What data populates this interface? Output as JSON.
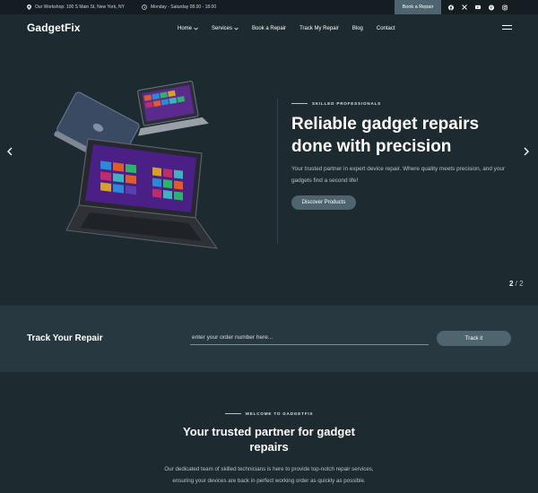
{
  "topbar": {
    "address": "Our Workshop: 100 S Main St, New York, NY",
    "hours": "Monday - Saturday 08.00 - 18.00",
    "cta_label": "Book a Repair",
    "socials": [
      "facebook-icon",
      "x-icon",
      "youtube-icon",
      "pinterest-icon",
      "instagram-icon"
    ]
  },
  "header": {
    "logo": "GadgetFix",
    "nav": [
      {
        "label": "Home",
        "dropdown": true
      },
      {
        "label": "Services",
        "dropdown": true
      },
      {
        "label": "Book a Repair",
        "dropdown": false
      },
      {
        "label": "Track My Repair",
        "dropdown": false
      },
      {
        "label": "Blog",
        "dropdown": false
      },
      {
        "label": "Contact",
        "dropdown": false
      }
    ]
  },
  "hero": {
    "eyebrow": "SKILLED PROFESSIONALS",
    "title": "Reliable gadget repairs done with precision",
    "description": "Your trusted partner in expert device repair. Where quality meets precision, and your gadgets find a second life!",
    "button": "Discover Products",
    "slide_current": "2",
    "slide_total": "2"
  },
  "track": {
    "title": "Track Your Repair",
    "placeholder": "enter your order number here...",
    "value": "",
    "button": "Track it"
  },
  "welcome": {
    "eyebrow": "WELCOME TO GADGETFIX",
    "title": "Your trusted partner for gadget repairs",
    "description": "Our dedicated team of skilled technicians is here to provide top-notch repair services, ensuring your devices are back in perfect working order as quickly as possible."
  },
  "colors": {
    "background": "#1d2a30",
    "topbar": "#141d22",
    "track_section": "#283840",
    "accent_button": "#4e6570"
  }
}
